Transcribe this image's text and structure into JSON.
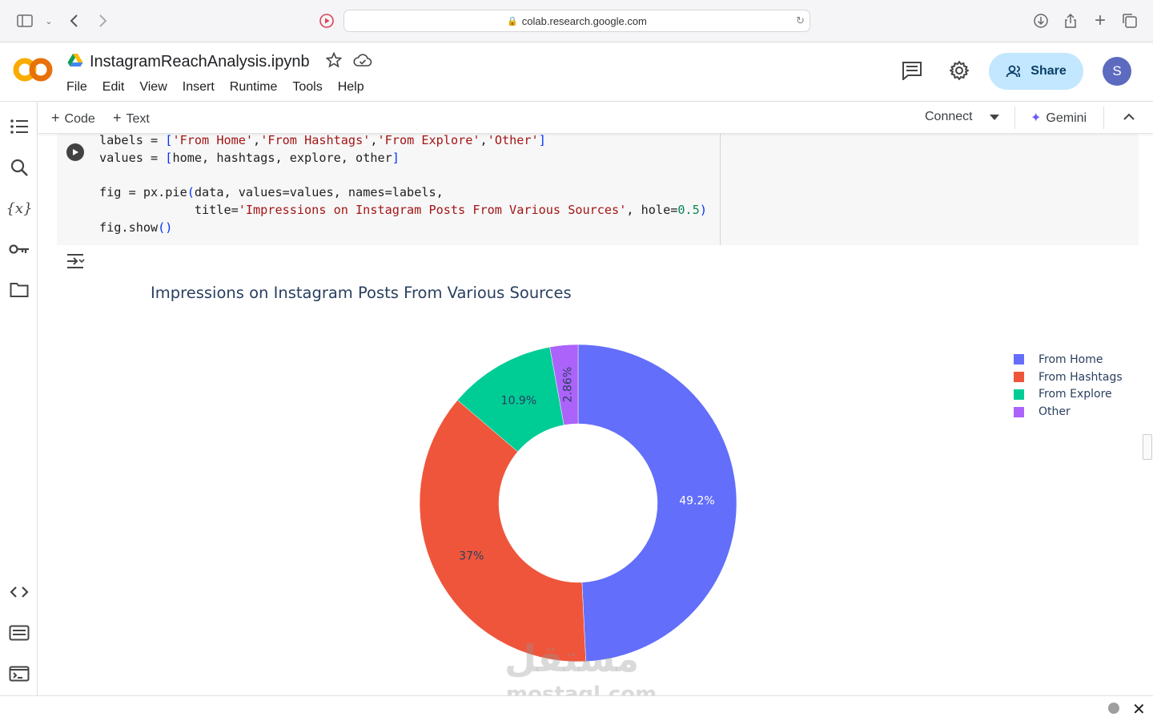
{
  "browser": {
    "url": "colab.research.google.com"
  },
  "header": {
    "notebook_title": "InstagramReachAnalysis.ipynb",
    "menu": [
      "File",
      "Edit",
      "View",
      "Insert",
      "Runtime",
      "Tools",
      "Help"
    ],
    "share_label": "Share",
    "avatar_initial": "S"
  },
  "toolbar": {
    "code_label": "Code",
    "text_label": "Text",
    "connect_label": "Connect",
    "gemini_label": "Gemini"
  },
  "cell": {
    "lines": [
      "labels = ['From Home','From Hashtags','From Explore','Other']",
      "values = [home, hashtags, explore, other]",
      "",
      "fig = px.pie(data, values=values, names=labels,",
      "             title='Impressions on Instagram Posts From Various Sources', hole=0.5)",
      "fig.show()"
    ]
  },
  "chart_data": {
    "type": "pie",
    "title": "Impressions on Instagram Posts From Various Sources",
    "hole": 0.5,
    "categories": [
      "From Home",
      "From Hashtags",
      "From Explore",
      "Other"
    ],
    "values": [
      49.2,
      37,
      10.9,
      2.86
    ],
    "labels": [
      "49.2%",
      "37%",
      "10.9%",
      "2.86%"
    ],
    "colors": [
      "#636efa",
      "#EF553B",
      "#00cc96",
      "#ab63fa"
    ],
    "legend_position": "top-right"
  },
  "watermark": {
    "arabic": "مستقل",
    "latin": "mostaql.com"
  }
}
